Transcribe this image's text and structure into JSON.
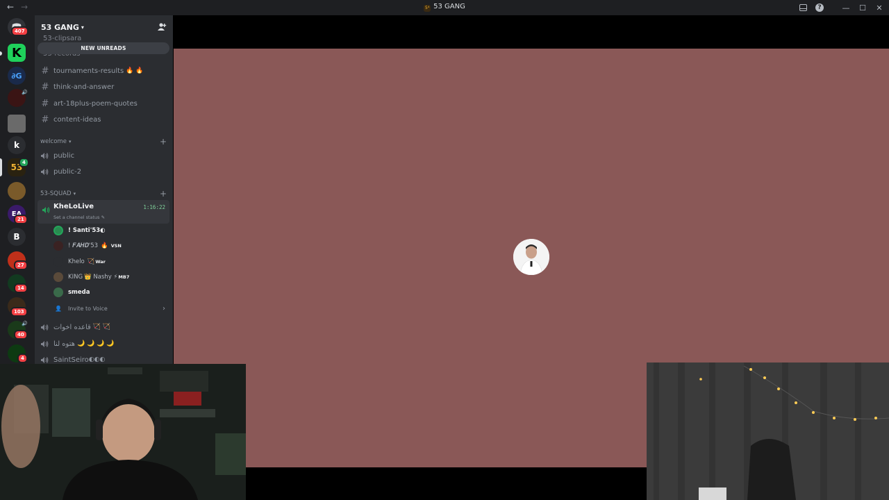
{
  "window": {
    "title": "53 GANG",
    "nav_back": "←",
    "nav_forward": "→",
    "title_glyph": "5⁴",
    "inbox_icon": "inbox-icon",
    "help_label": "?",
    "minimize": "—",
    "maximize": "☐",
    "close": "✕"
  },
  "rail": {
    "home_badge": "407",
    "server_k_letter": "k",
    "server_b_letter": "B",
    "server_ea_text": "EA",
    "server_53_text": "53",
    "badges": [
      "407",
      "21",
      "27",
      "14",
      "103",
      "40",
      "4"
    ],
    "small_badge_53": "4"
  },
  "sidebar": {
    "server_name": "53 GANG",
    "ghost_rows": [
      "53-clipsara",
      "53-records"
    ],
    "new_unreads": "NEW UNREADS",
    "channels": [
      {
        "name": "tournaments-results",
        "emoji": "🔥 🔥"
      },
      {
        "name": "think-and-answer",
        "emoji": ""
      },
      {
        "name": "art-18plus-poem-quotes",
        "emoji": ""
      },
      {
        "name": "content-ideas",
        "emoji": ""
      }
    ],
    "category_welcome": "welcome",
    "welcome_channels": [
      "public",
      "public-2"
    ],
    "category_squad": "53-SQUAD",
    "active_voice": {
      "name": "KheLoLive",
      "timer": "1:16:22",
      "status": "Set a channel status"
    },
    "members": [
      {
        "name": "! Santi'53",
        "suffix": "◐",
        "tag": ""
      },
      {
        "name": "! 𝑭𝑨𝑯𝑫'53",
        "suffix": "🔥",
        "tag": "VSN"
      },
      {
        "name": "Khelo",
        "suffix": "🏹",
        "tag": "War"
      },
      {
        "name": "KING",
        "suffix": "👑 Nashy ⚡",
        "tag": "MB7"
      },
      {
        "name": "smeda",
        "suffix": "",
        "tag": ""
      }
    ],
    "invite_label": "Invite to Voice",
    "more_voice": [
      {
        "name": "قاعده اخوات",
        "emoji": "🏹 🏹"
      },
      {
        "name": "هتوه لنا",
        "emoji": "🌙 🌙 🌙 🌙"
      },
      {
        "name": "SaintSeiro",
        "emoji": "◐◐◐"
      }
    ]
  },
  "colors": {
    "stage_bg": "#8a5857",
    "sidebar_bg": "#2b2d31",
    "rail_bg": "#1e1f22",
    "badge_red": "#f23f43",
    "voice_green": "#23a55a"
  }
}
